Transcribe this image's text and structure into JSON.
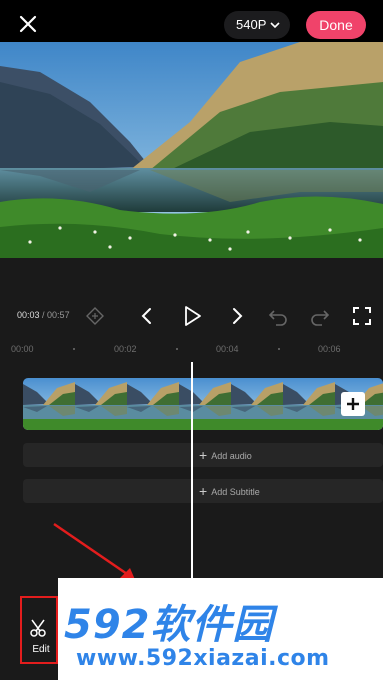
{
  "topbar": {
    "resolution_label": "540P",
    "done_label": "Done"
  },
  "player": {
    "current_time": "00:03",
    "total_time": "/ 00:57"
  },
  "ruler": {
    "labels": [
      "00:00",
      "00:02",
      "00:04",
      "00:06"
    ]
  },
  "tracks": {
    "audio_label": "Add audio",
    "subtitle_label": "Add Subtitle",
    "plus": "+"
  },
  "toolbar": {
    "edit_label": "Edit"
  },
  "watermark": {
    "brand": "592软件园",
    "url": "www.592xiazai.com"
  },
  "colors": {
    "accent": "#f0436a",
    "highlight_box": "#e31d1d",
    "watermark_blue": "#2f84e8"
  }
}
